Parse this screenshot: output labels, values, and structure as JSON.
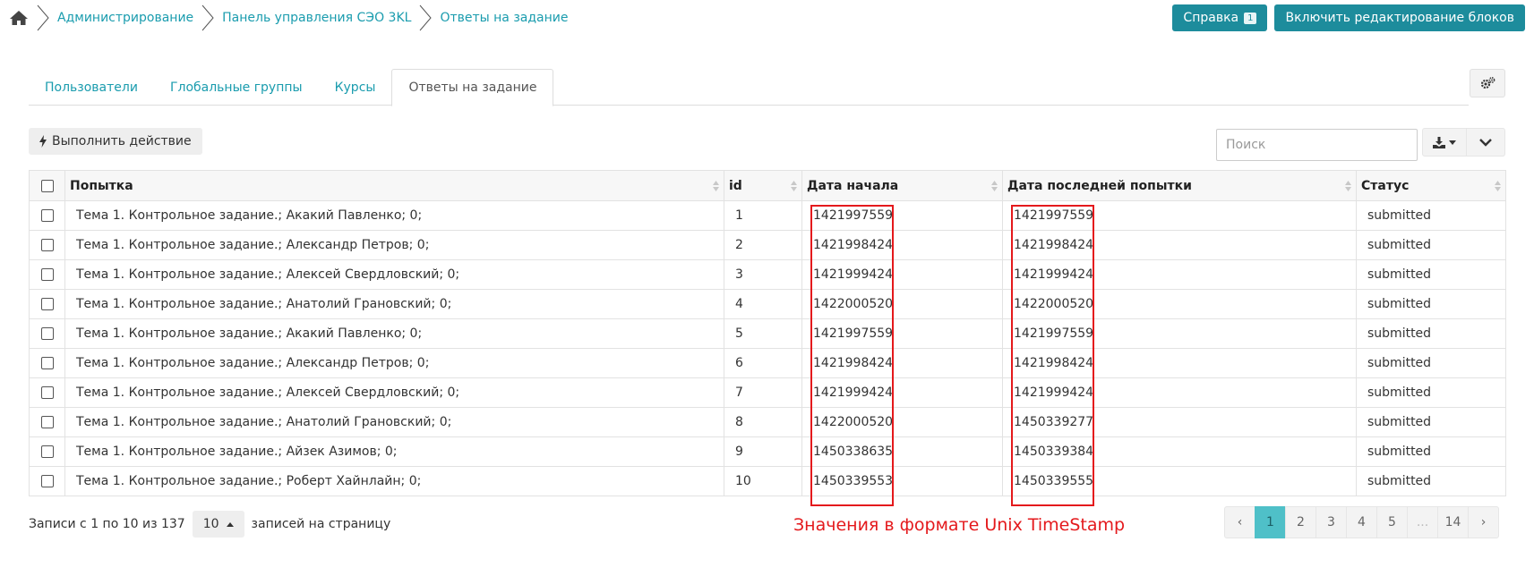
{
  "breadcrumb": {
    "items": [
      "Администрирование",
      "Панель управления СЭО 3KL",
      "Ответы на задание"
    ]
  },
  "header_buttons": {
    "help_label": "Справка",
    "help_badge": "1",
    "edit_blocks_label": "Включить редактирование блоков"
  },
  "tabs": [
    {
      "label": "Пользователи",
      "active": false
    },
    {
      "label": "Глобальные группы",
      "active": false
    },
    {
      "label": "Курсы",
      "active": false
    },
    {
      "label": "Ответы на задание",
      "active": true
    }
  ],
  "toolbar": {
    "action_label": "Выполнить действие",
    "search_placeholder": "Поиск"
  },
  "table": {
    "columns": [
      "Попытка",
      "id",
      "Дата начала",
      "Дата последней попытки",
      "Статус"
    ],
    "rows": [
      {
        "attempt": "Тема 1. Контрольное задание.; Акакий Павленко; 0;",
        "id": "1",
        "start": "1421997559",
        "last": "1421997559",
        "status": "submitted"
      },
      {
        "attempt": "Тема 1. Контрольное задание.; Александр Петров; 0;",
        "id": "2",
        "start": "1421998424",
        "last": "1421998424",
        "status": "submitted"
      },
      {
        "attempt": "Тема 1. Контрольное задание.; Алексей Свердловский; 0;",
        "id": "3",
        "start": "1421999424",
        "last": "1421999424",
        "status": "submitted"
      },
      {
        "attempt": "Тема 1. Контрольное задание.; Анатолий Грановский; 0;",
        "id": "4",
        "start": "1422000520",
        "last": "1422000520",
        "status": "submitted"
      },
      {
        "attempt": "Тема 1. Контрольное задание.; Акакий Павленко; 0;",
        "id": "5",
        "start": "1421997559",
        "last": "1421997559",
        "status": "submitted"
      },
      {
        "attempt": "Тема 1. Контрольное задание.; Александр Петров; 0;",
        "id": "6",
        "start": "1421998424",
        "last": "1421998424",
        "status": "submitted"
      },
      {
        "attempt": "Тема 1. Контрольное задание.; Алексей Свердловский; 0;",
        "id": "7",
        "start": "1421999424",
        "last": "1421999424",
        "status": "submitted"
      },
      {
        "attempt": "Тема 1. Контрольное задание.; Анатолий Грановский; 0;",
        "id": "8",
        "start": "1422000520",
        "last": "1450339277",
        "status": "submitted"
      },
      {
        "attempt": "Тема 1. Контрольное задание.; Айзек Азимов; 0;",
        "id": "9",
        "start": "1450338635",
        "last": "1450339384",
        "status": "submitted"
      },
      {
        "attempt": "Тема 1. Контрольное задание.; Роберт Хайнлайн; 0;",
        "id": "10",
        "start": "1450339553",
        "last": "1450339555",
        "status": "submitted"
      }
    ]
  },
  "annotation": {
    "text": "Значения в формате Unix TimeStamp",
    "color": "#e4191c"
  },
  "footer": {
    "records_text": "Записи с 1 по 10 из 137",
    "page_size": "10",
    "per_page_text": "записей на страницу"
  },
  "pagination": {
    "prev": "‹",
    "pages": [
      "1",
      "2",
      "3",
      "4",
      "5",
      "...",
      "14"
    ],
    "active": "1",
    "next": "›"
  },
  "colors": {
    "accent": "#1a9cae",
    "button_teal": "#1d8c9c",
    "active_page": "#4fc0c8"
  }
}
